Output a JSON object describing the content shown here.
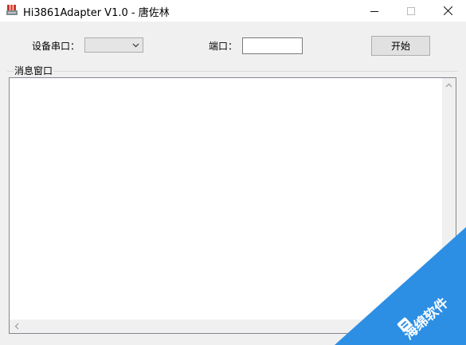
{
  "window": {
    "title": "Hi3861Adapter V1.0 - 唐佐林"
  },
  "controls": {
    "device_port_label": "设备串口：",
    "device_port_value": "",
    "port_label": "端口：",
    "port_value": "",
    "start_button": "开始"
  },
  "message_window": {
    "label": "消息窗口",
    "content": ""
  },
  "watermark": {
    "text": "海绵软件"
  },
  "colors": {
    "titlebar": "#ffffff",
    "window_bg": "#f0f0f0",
    "watermark": "#2d8fe4"
  }
}
